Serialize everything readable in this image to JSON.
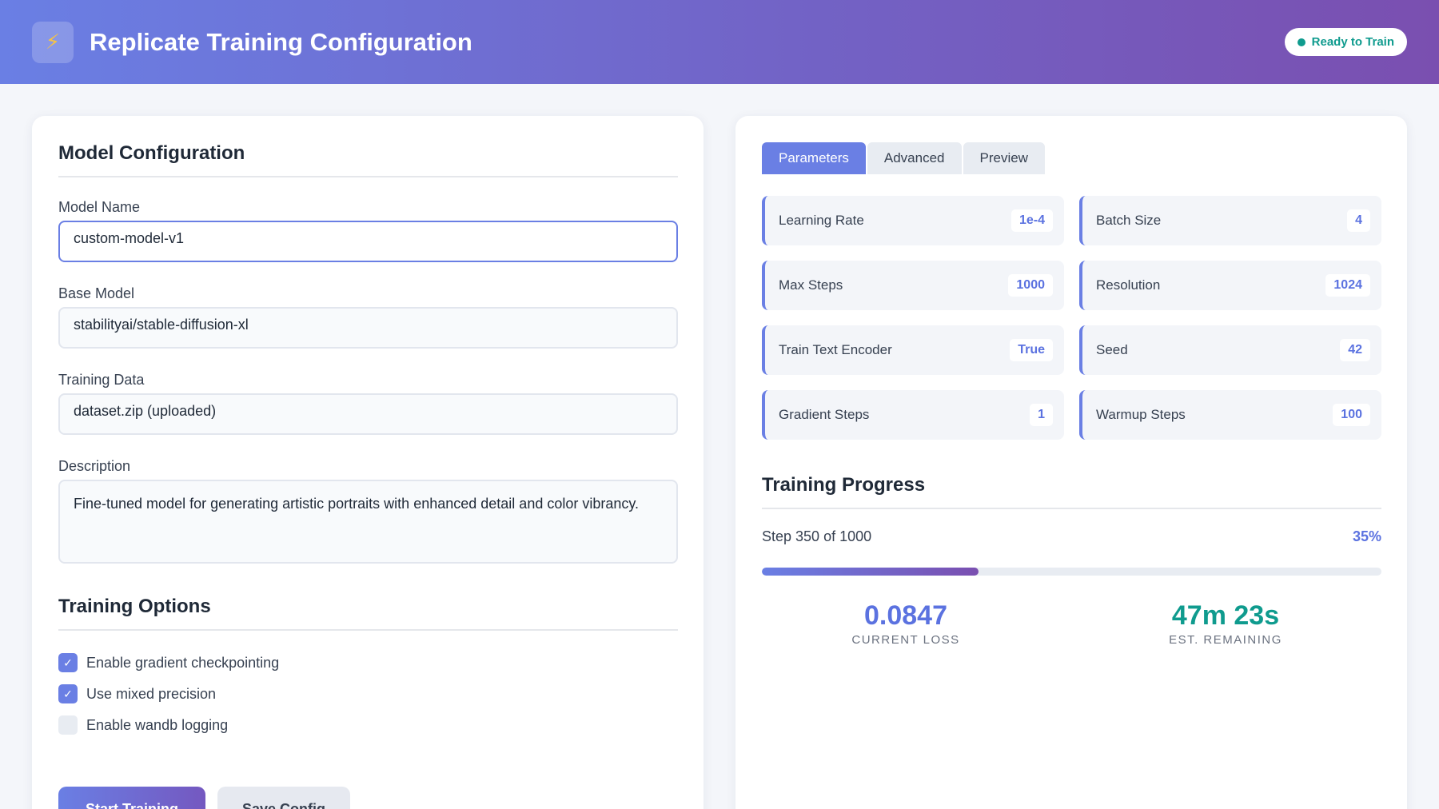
{
  "header": {
    "logo_glyph": "⚡",
    "title": "Replicate Training Configuration",
    "status": "Ready to Train",
    "status_color": "#0f9b8e",
    "accent": "#6a7fe4"
  },
  "model_config": {
    "section_title": "Model Configuration",
    "fields": [
      {
        "label": "Model Name",
        "value": "custom-model-v1"
      },
      {
        "label": "Base Model",
        "value": "stabilityai/stable-diffusion-xl"
      },
      {
        "label": "Training Data",
        "value": "dataset.zip (uploaded)"
      },
      {
        "label": "Description",
        "value": "Fine-tuned model for generating artistic portraits with enhanced detail and color vibrancy."
      }
    ]
  },
  "training_options": {
    "section_title": "Training Options",
    "options": [
      {
        "label": "Enable gradient checkpointing",
        "checked": true
      },
      {
        "label": "Use mixed precision",
        "checked": true
      },
      {
        "label": "Enable wandb logging",
        "checked": false
      }
    ]
  },
  "actions": {
    "start_label": "Start Training",
    "save_label": "Save Config"
  },
  "tabs": [
    {
      "label": "Parameters",
      "active": true
    },
    {
      "label": "Advanced",
      "active": false
    },
    {
      "label": "Preview",
      "active": false
    }
  ],
  "parameters": [
    {
      "name": "Learning Rate",
      "value": "1e-4"
    },
    {
      "name": "Batch Size",
      "value": "4"
    },
    {
      "name": "Max Steps",
      "value": "1000"
    },
    {
      "name": "Resolution",
      "value": "1024"
    },
    {
      "name": "Train Text Encoder",
      "value": "True"
    },
    {
      "name": "Seed",
      "value": "42"
    },
    {
      "name": "Gradient Steps",
      "value": "1"
    },
    {
      "name": "Warmup Steps",
      "value": "100"
    }
  ],
  "progress": {
    "section_title": "Training Progress",
    "step_text": "Step 350 of 1000",
    "percent_text": "35%",
    "fraction": 0.35,
    "loss_value": "0.0847",
    "loss_label": "CURRENT LOSS",
    "loss_color": "#5b72e0",
    "remaining_value": "47m 23s",
    "remaining_label": "EST. REMAINING",
    "remaining_color": "#0f9b8e"
  }
}
